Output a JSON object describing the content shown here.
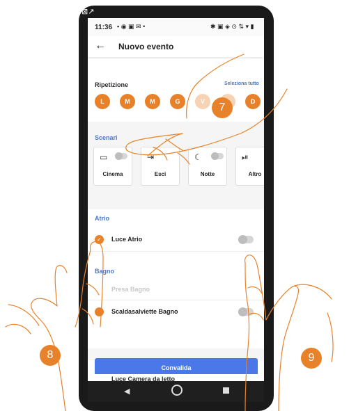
{
  "status_bar": {
    "time": "11:36"
  },
  "app_bar": {
    "title": "Nuovo evento"
  },
  "repeat": {
    "title": "Ripetizione",
    "select_all": "Seleziona tutto",
    "days": [
      "L",
      "M",
      "M",
      "G",
      "V",
      "S",
      "D"
    ]
  },
  "scenarios": {
    "title": "Scenari",
    "items": [
      {
        "label": "Cinema",
        "icon": "tv-icon"
      },
      {
        "label": "Esci",
        "icon": "exit-icon"
      },
      {
        "label": "Notte",
        "icon": "moon-icon"
      },
      {
        "label": "Altro",
        "icon": "skip-icon"
      }
    ]
  },
  "rooms": [
    {
      "name": "Atrio",
      "items": [
        {
          "label": "Luce Atrio",
          "checked": true
        }
      ]
    },
    {
      "name": "Bagno",
      "items": [
        {
          "label": "Presa Bagno",
          "checked": false,
          "disabled": true
        },
        {
          "label": "Scaldasalviette Bagno",
          "checked": false
        }
      ]
    }
  ],
  "bottom_item": "Luce Camera da letto",
  "confirm_button": "Convalida",
  "callouts": [
    "7",
    "8",
    "9"
  ],
  "colors": {
    "accent": "#e8822a",
    "primary": "#4a78e8",
    "section": "#4a78c8"
  }
}
